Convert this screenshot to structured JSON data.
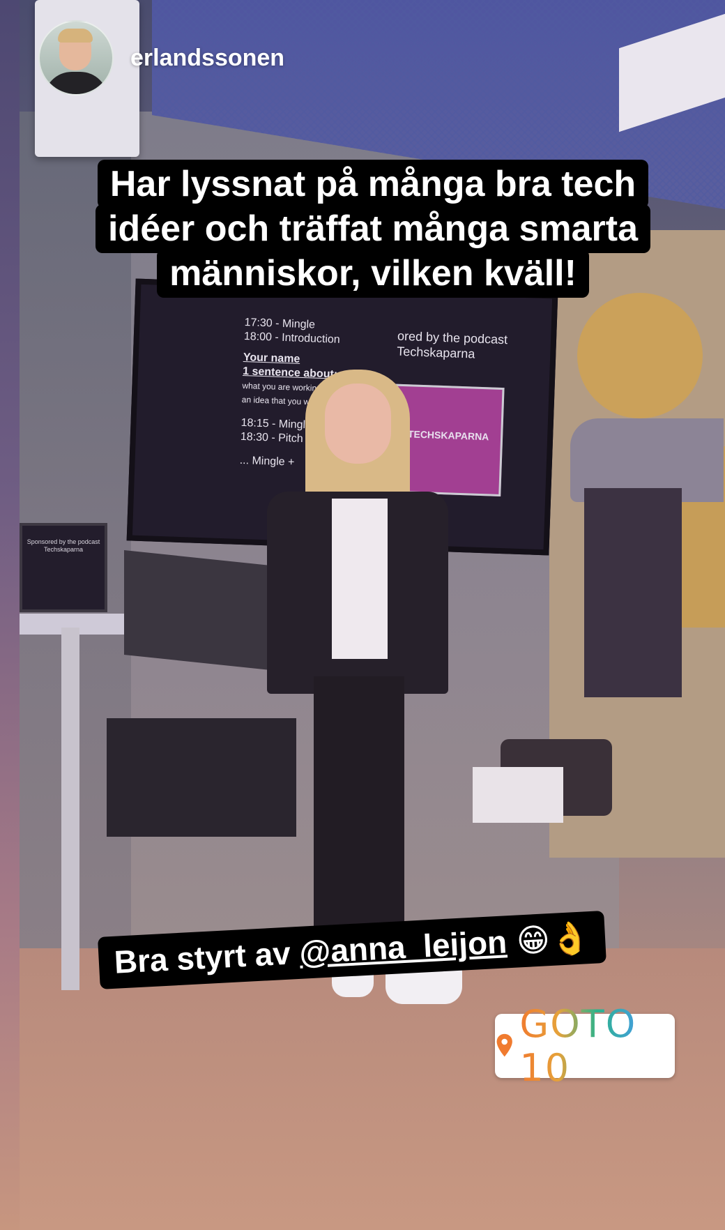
{
  "story": {
    "username": "erlandssonen",
    "avatar_icon": "user-avatar",
    "caption_main": "Har lyssnat på många bra tech idéer och träffat många smarta människor, vilken kväll!",
    "caption_bottom_prefix": "Bra styrt av ",
    "caption_bottom_mention": "@anna_leijon",
    "caption_bottom_emoji": "😁👌",
    "location": {
      "icon": "location-pin-icon",
      "name": "GOTO 10",
      "gradient_colors": [
        "#f07b2f",
        "#e6a23a",
        "#2db38b",
        "#3fa2d0",
        "#9c6ad4"
      ]
    }
  },
  "screen": {
    "schedule_lines": [
      "17:30 - Mingle",
      "18:00 - Introduction",
      "Your name",
      "1 sentence about:",
      "what you are working on",
      "an idea that you would want to",
      "18:15 - Mingle +",
      "18:30 - Pitch tim",
      "... Mingle +"
    ],
    "sponsor_lines": [
      "ored by the podcast",
      "Techskaparna"
    ],
    "logo_text": "TECHSKAPARNA"
  },
  "laptop_screen": {
    "lines": [
      "Sponsored by the podcast",
      "Techskaparna"
    ]
  }
}
